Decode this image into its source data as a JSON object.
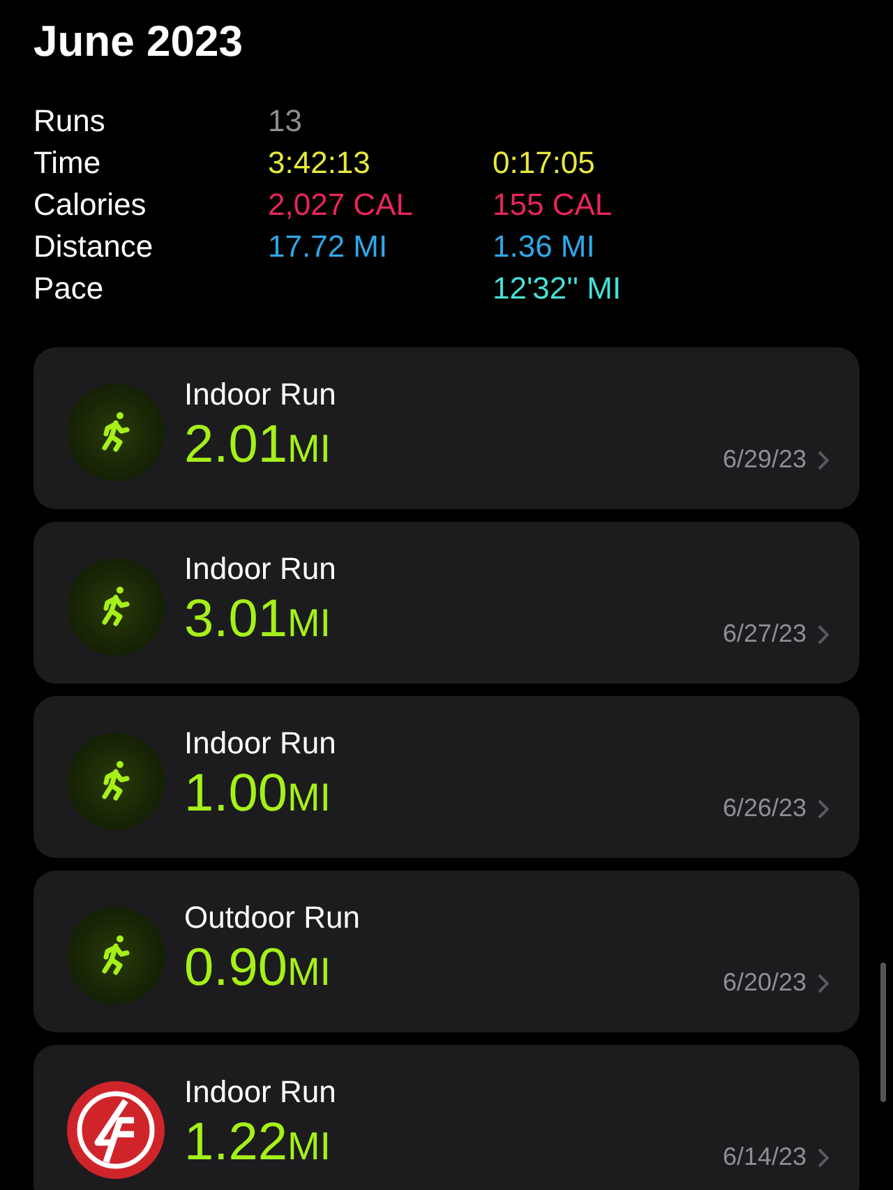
{
  "title": "June 2023",
  "stats": [
    {
      "label": "Runs",
      "value": "13",
      "color": "#8e8e93"
    },
    {
      "label": "Time",
      "value": "3:42:13",
      "value_2": "0:17:05",
      "color": "#e6ea3c"
    },
    {
      "label": "Calories",
      "value": "2,027 CAL",
      "value_2": "155 CAL",
      "color": "#e8265a"
    },
    {
      "label": "Distance",
      "value": "17.72 MI",
      "value_2": "1.36 MI",
      "color": "#2fa8e8"
    },
    {
      "label": "Pace",
      "value_2": "12'32'' MI",
      "color": "#46e0d6"
    }
  ],
  "workouts": [
    {
      "kind": "run",
      "name": "Indoor Run",
      "distance": "2.01",
      "unit": "MI",
      "date": "6/29/23"
    },
    {
      "kind": "run",
      "name": "Indoor Run",
      "distance": "3.01",
      "unit": "MI",
      "date": "6/27/23"
    },
    {
      "kind": "run",
      "name": "Indoor Run",
      "distance": "1.00",
      "unit": "MI",
      "date": "6/26/23"
    },
    {
      "kind": "run",
      "name": "Outdoor Run",
      "distance": "0.90",
      "unit": "MI",
      "date": "6/20/23"
    },
    {
      "kind": "brand",
      "name": "Indoor Run",
      "distance": "1.22",
      "unit": "MI",
      "date": "6/14/23"
    }
  ]
}
